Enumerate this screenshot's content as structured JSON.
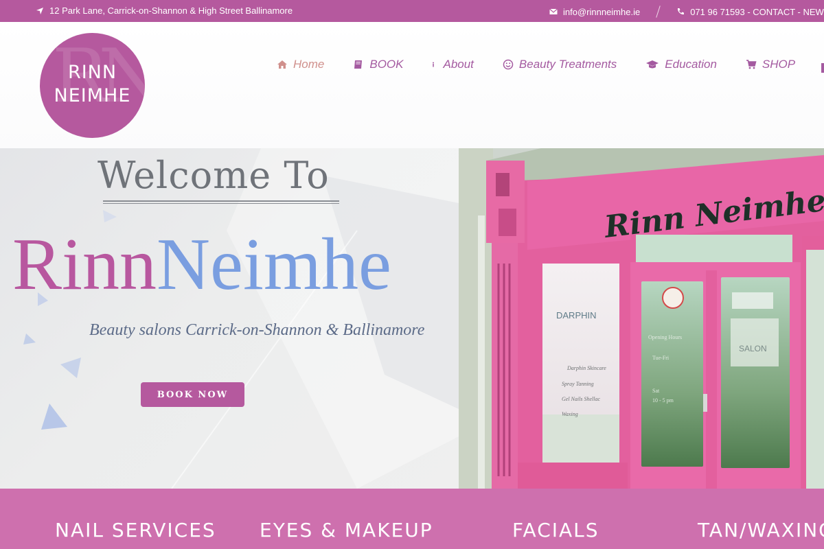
{
  "topbar": {
    "address": "12 Park Lane, Carrick-on-Shannon & High Street Ballinamore",
    "email": "info@rinnneimhe.ie",
    "contact": "071 96 71593 - CONTACT - NEW"
  },
  "logo": {
    "line1": "RINN",
    "line2": "NEIMHE",
    "monogram": "RN"
  },
  "nav": {
    "items": [
      {
        "label": "Home",
        "icon": "home-icon"
      },
      {
        "label": "BOOK",
        "icon": "book-icon"
      },
      {
        "label": "About",
        "icon": "info-icon"
      },
      {
        "label": "Beauty Treatments",
        "icon": "smile-icon"
      },
      {
        "label": "Education",
        "icon": "graduation-cap-icon"
      },
      {
        "label": "SHOP",
        "icon": "cart-icon"
      }
    ]
  },
  "hero": {
    "welcome": "Welcome To",
    "brand_part1": "Rinn",
    "brand_part2": "Neimhe",
    "tagline": "Beauty salons Carrick-on-Shannon & Ballinamore",
    "book_now": "BOOK NOW",
    "shop_sign": "Rinn Neimhe",
    "window_brand": "DARPHIN",
    "door_badge": "SALON"
  },
  "services": [
    "NAIL SERVICES",
    "EYES & MAKEUP",
    "FACIALS",
    "TAN/WAXING"
  ],
  "colors": {
    "brand_pink": "#b5599e",
    "service_bar": "#ce70ae",
    "accent_blue": "#7a9ee0"
  }
}
